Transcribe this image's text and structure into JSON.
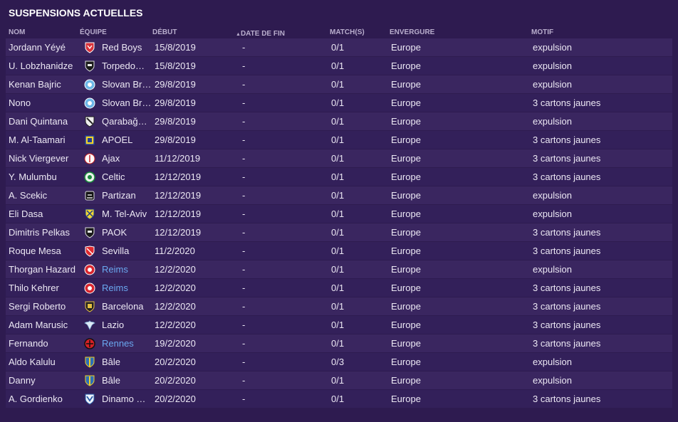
{
  "title": "SUSPENSIONS ACTUELLES",
  "columns": {
    "nom": "NOM",
    "equipe": "ÉQUIPE",
    "debut": "DÉBUT",
    "date_fin": "DATE DE FIN",
    "matchs": "MATCH(S)",
    "envergure": "ENVERGURE",
    "motif": "MOTIF"
  },
  "sort_indicator": "▲",
  "rows": [
    {
      "nom": "Jordann Yéyé",
      "team": "Red Boys",
      "crest": "red-shield-crest-icon",
      "link": false,
      "debut": "15/8/2019",
      "fin": "-",
      "matchs": "0/1",
      "env": "Europe",
      "motif": "expulsion"
    },
    {
      "nom": "U. Lobzhanidze",
      "team": "Torpedo…",
      "crest": "black-shield-crest-icon",
      "link": false,
      "debut": "15/8/2019",
      "fin": "-",
      "matchs": "0/1",
      "env": "Europe",
      "motif": "expulsion"
    },
    {
      "nom": "Kenan Bajric",
      "team": "Slovan Br…",
      "crest": "blue-round-crest-icon",
      "link": false,
      "debut": "29/8/2019",
      "fin": "-",
      "matchs": "0/1",
      "env": "Europe",
      "motif": "expulsion"
    },
    {
      "nom": "Nono",
      "team": "Slovan Br…",
      "crest": "blue-round-crest-icon",
      "link": false,
      "debut": "29/8/2019",
      "fin": "-",
      "matchs": "0/1",
      "env": "Europe",
      "motif": "3 cartons jaunes"
    },
    {
      "nom": "Dani Quintana",
      "team": "Qarabağ…",
      "crest": "white-black-shield-crest-icon",
      "link": false,
      "debut": "29/8/2019",
      "fin": "-",
      "matchs": "0/1",
      "env": "Europe",
      "motif": "expulsion"
    },
    {
      "nom": "M. Al-Taamari",
      "team": "APOEL",
      "crest": "yellow-blue-crest-icon",
      "link": false,
      "debut": "29/8/2019",
      "fin": "-",
      "matchs": "0/1",
      "env": "Europe",
      "motif": "3 cartons jaunes"
    },
    {
      "nom": "Nick Viergever",
      "team": "Ajax",
      "crest": "white-round-crest-icon",
      "link": false,
      "debut": "11/12/2019",
      "fin": "-",
      "matchs": "0/1",
      "env": "Europe",
      "motif": "3 cartons jaunes"
    },
    {
      "nom": "Y. Mulumbu",
      "team": "Celtic",
      "crest": "green-round-crest-icon",
      "link": false,
      "debut": "12/12/2019",
      "fin": "-",
      "matchs": "0/1",
      "env": "Europe",
      "motif": "3 cartons jaunes"
    },
    {
      "nom": "A. Scekic",
      "team": "Partizan",
      "crest": "black-white-crest-icon",
      "link": false,
      "debut": "12/12/2019",
      "fin": "-",
      "matchs": "0/1",
      "env": "Europe",
      "motif": "expulsion"
    },
    {
      "nom": "Eli Dasa",
      "team": "M. Tel-Aviv",
      "crest": "yellow-blue-shield-crest-icon",
      "link": false,
      "debut": "12/12/2019",
      "fin": "-",
      "matchs": "0/1",
      "env": "Europe",
      "motif": "expulsion"
    },
    {
      "nom": "Dimitris Pelkas",
      "team": "PAOK",
      "crest": "black-shield-crest-icon",
      "link": false,
      "debut": "12/12/2019",
      "fin": "-",
      "matchs": "0/1",
      "env": "Europe",
      "motif": "3 cartons jaunes"
    },
    {
      "nom": "Roque Mesa",
      "team": "Sevilla",
      "crest": "red-white-crest-icon",
      "link": false,
      "debut": "11/2/2020",
      "fin": "-",
      "matchs": "0/1",
      "env": "Europe",
      "motif": "3 cartons jaunes"
    },
    {
      "nom": "Thorgan Hazard",
      "team": "Reims",
      "crest": "red-round-crest-icon",
      "link": true,
      "debut": "12/2/2020",
      "fin": "-",
      "matchs": "0/1",
      "env": "Europe",
      "motif": "expulsion"
    },
    {
      "nom": "Thilo Kehrer",
      "team": "Reims",
      "crest": "red-round-crest-icon",
      "link": true,
      "debut": "12/2/2020",
      "fin": "-",
      "matchs": "0/1",
      "env": "Europe",
      "motif": "3 cartons jaunes"
    },
    {
      "nom": "Sergi Roberto",
      "team": "Barcelona",
      "crest": "black-yellow-shield-crest-icon",
      "link": false,
      "debut": "12/2/2020",
      "fin": "-",
      "matchs": "0/1",
      "env": "Europe",
      "motif": "3 cartons jaunes"
    },
    {
      "nom": "Adam Marusic",
      "team": "Lazio",
      "crest": "eagle-crest-icon",
      "link": false,
      "debut": "12/2/2020",
      "fin": "-",
      "matchs": "0/1",
      "env": "Europe",
      "motif": "3 cartons jaunes"
    },
    {
      "nom": "Fernando",
      "team": "Rennes",
      "crest": "red-black-crest-icon",
      "link": true,
      "debut": "19/2/2020",
      "fin": "-",
      "matchs": "0/1",
      "env": "Europe",
      "motif": "3 cartons jaunes"
    },
    {
      "nom": "Aldo Kalulu",
      "team": "Bâle",
      "crest": "blue-yellow-shield-crest-icon",
      "link": false,
      "debut": "20/2/2020",
      "fin": "-",
      "matchs": "0/3",
      "env": "Europe",
      "motif": "expulsion"
    },
    {
      "nom": "Danny",
      "team": "Bâle",
      "crest": "blue-yellow-shield-crest-icon",
      "link": false,
      "debut": "20/2/2020",
      "fin": "-",
      "matchs": "0/1",
      "env": "Europe",
      "motif": "expulsion"
    },
    {
      "nom": "A. Gordienko",
      "team": "Dinamo Ki…",
      "crest": "blue-white-shield-crest-icon",
      "link": false,
      "debut": "20/2/2020",
      "fin": "-",
      "matchs": "0/1",
      "env": "Europe",
      "motif": "3 cartons jaunes"
    }
  ],
  "colors": {
    "background": "#2e1b50",
    "row_odd": "#3a2660",
    "row_even": "#33205a",
    "header_text": "#b9aecd",
    "link_text": "#6aa8f0"
  }
}
